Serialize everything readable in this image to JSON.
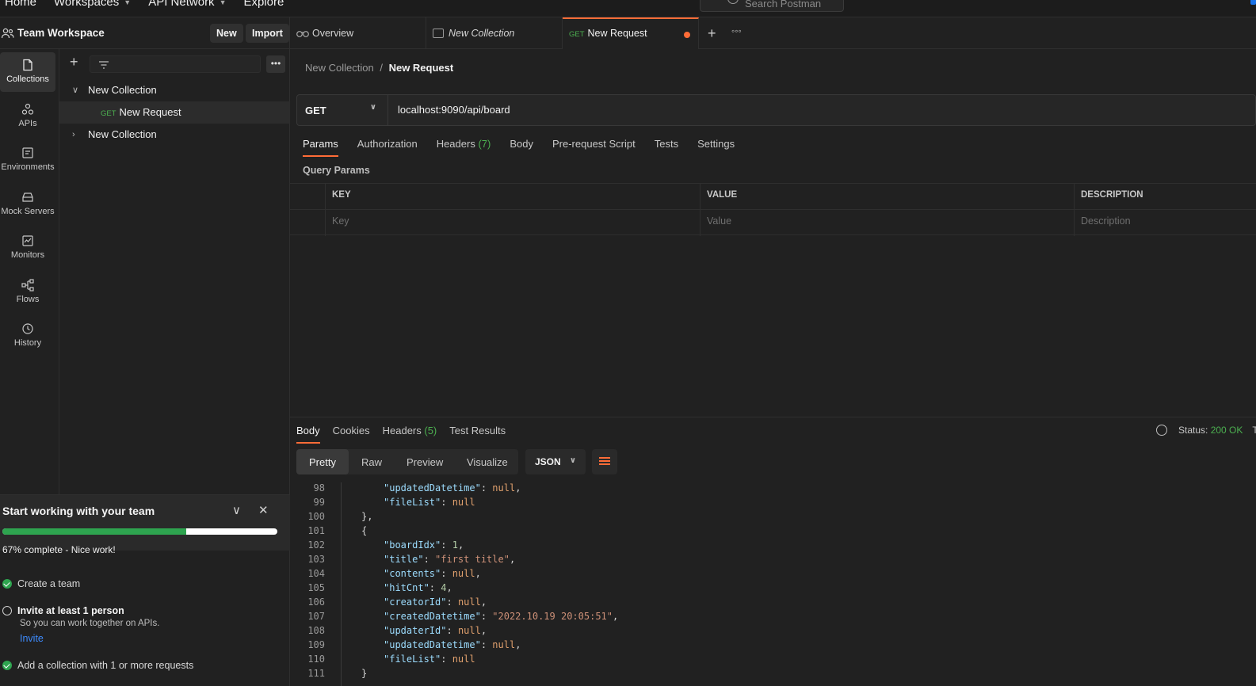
{
  "topbar": {
    "nav": [
      "Home",
      "Workspaces",
      "API Network",
      "Explore"
    ],
    "search_placeholder": "Search Postman"
  },
  "workspace": {
    "title": "Team Workspace",
    "new_label": "New",
    "import_label": "Import"
  },
  "rail": [
    {
      "label": "Collections",
      "icon": "collections-icon"
    },
    {
      "label": "APIs",
      "icon": "apis-icon"
    },
    {
      "label": "Environments",
      "icon": "environments-icon"
    },
    {
      "label": "Mock Servers",
      "icon": "mock-servers-icon"
    },
    {
      "label": "Monitors",
      "icon": "monitors-icon"
    },
    {
      "label": "Flows",
      "icon": "flows-icon"
    },
    {
      "label": "History",
      "icon": "history-icon"
    }
  ],
  "tree": {
    "collection1": "New Collection",
    "request_method": "GET",
    "request_name": "New Request",
    "collection2": "New Collection"
  },
  "onboarding": {
    "title": "Start working with your team",
    "progress": 0.67,
    "progress_text": "67% complete - Nice work!",
    "task1": "Create a team",
    "task2": "Invite at least 1 person",
    "task2_sub": "So you can work together on APIs.",
    "invite_label": "Invite",
    "task3": "Add a collection with 1 or more requests"
  },
  "tabs": {
    "overview": "Overview",
    "collection": "New Collection",
    "request_method": "GET",
    "request": "New Request"
  },
  "breadcrumb": {
    "parent": "New Collection",
    "separator": "/",
    "current": "New Request"
  },
  "request": {
    "method": "GET",
    "url": "localhost:9090/api/board",
    "tabs": {
      "params": "Params",
      "authorization": "Authorization",
      "headers": "Headers",
      "headers_count": "(7)",
      "body": "Body",
      "prerequest": "Pre-request Script",
      "tests": "Tests",
      "settings": "Settings"
    },
    "query_params_title": "Query Params",
    "columns": {
      "key": "KEY",
      "value": "VALUE",
      "description": "DESCRIPTION"
    },
    "placeholders": {
      "key": "Key",
      "value": "Value",
      "description": "Description"
    }
  },
  "response": {
    "tabs": {
      "body": "Body",
      "cookies": "Cookies",
      "headers": "Headers",
      "headers_count": "(5)",
      "test_results": "Test Results"
    },
    "status_label": "Status:",
    "status_value": "200 OK",
    "status_trailing": "T",
    "formats": [
      "Pretty",
      "Raw",
      "Preview",
      "Visualize"
    ],
    "language": "JSON",
    "code_lines": [
      {
        "n": "98",
        "indent": "    ",
        "key": "updatedDatetime",
        "val": "null",
        "type": "null",
        "trail": ","
      },
      {
        "n": "99",
        "indent": "    ",
        "key": "fileList",
        "val": "null",
        "type": "null",
        "trail": ""
      },
      {
        "n": "100",
        "indent": "",
        "raw": "},"
      },
      {
        "n": "101",
        "indent": "",
        "raw": "{"
      },
      {
        "n": "102",
        "indent": "    ",
        "key": "boardIdx",
        "val": "1",
        "type": "num",
        "trail": ","
      },
      {
        "n": "103",
        "indent": "    ",
        "key": "title",
        "val": "\"first title\"",
        "type": "str",
        "trail": ","
      },
      {
        "n": "104",
        "indent": "    ",
        "key": "contents",
        "val": "null",
        "type": "null",
        "trail": ","
      },
      {
        "n": "105",
        "indent": "    ",
        "key": "hitCnt",
        "val": "4",
        "type": "num",
        "trail": ","
      },
      {
        "n": "106",
        "indent": "    ",
        "key": "creatorId",
        "val": "null",
        "type": "null",
        "trail": ","
      },
      {
        "n": "107",
        "indent": "    ",
        "key": "createdDatetime",
        "val": "\"2022.10.19 20:05:51\"",
        "type": "str",
        "trail": ","
      },
      {
        "n": "108",
        "indent": "    ",
        "key": "updaterId",
        "val": "null",
        "type": "null",
        "trail": ","
      },
      {
        "n": "109",
        "indent": "    ",
        "key": "updatedDatetime",
        "val": "null",
        "type": "null",
        "trail": ","
      },
      {
        "n": "110",
        "indent": "    ",
        "key": "fileList",
        "val": "null",
        "type": "null",
        "trail": ""
      },
      {
        "n": "111",
        "indent": "",
        "raw": "}"
      }
    ]
  },
  "colors": {
    "accent": "#ff6c37",
    "success": "#2ea44f",
    "link": "#3d8bfd"
  }
}
